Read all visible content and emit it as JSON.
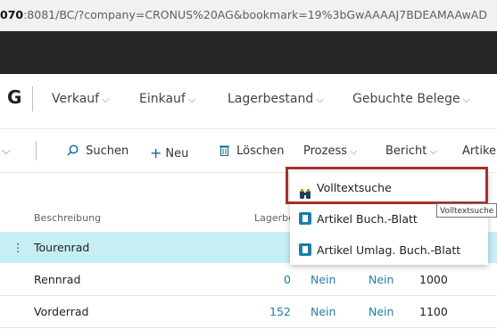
{
  "browser": {
    "url_prefix": "070",
    "url_rest": ":8081/BC/?company=CRONUS%20AG&bookmark=19%3bGwAAAAJ7BDEAMAAwAD"
  },
  "nav": {
    "company": "G",
    "items": [
      {
        "label": "Verkauf"
      },
      {
        "label": "Einkauf"
      },
      {
        "label": "Lagerbestand"
      },
      {
        "label": "Gebuchte Belege"
      }
    ]
  },
  "actions": {
    "search": "Suchen",
    "new": "Neu",
    "delete": "Löschen",
    "process": "Prozess",
    "report": "Bericht",
    "article": "Artike"
  },
  "columns": {
    "description": "Beschreibung",
    "inventory": "Lagerbesta"
  },
  "rows": [
    {
      "description": "Tourenrad",
      "inventory": "",
      "c1": "",
      "c2": "",
      "c3": ""
    },
    {
      "description": "Rennrad",
      "inventory": "0",
      "c1": "Nein",
      "c2": "Nein",
      "c3": "1000"
    },
    {
      "description": "Vorderrad",
      "inventory": "152",
      "c1": "Nein",
      "c2": "Nein",
      "c3": "1100"
    }
  ],
  "menu": {
    "items": [
      {
        "label": "Volltextsuche",
        "icon": "binoculars-icon"
      },
      {
        "label": "Artikel Buch.-Blatt",
        "icon": "journal-icon"
      },
      {
        "label": "Artikel Umlag. Buch.-Blatt",
        "icon": "journal-icon"
      }
    ],
    "tooltip": "Volltextsuche"
  }
}
